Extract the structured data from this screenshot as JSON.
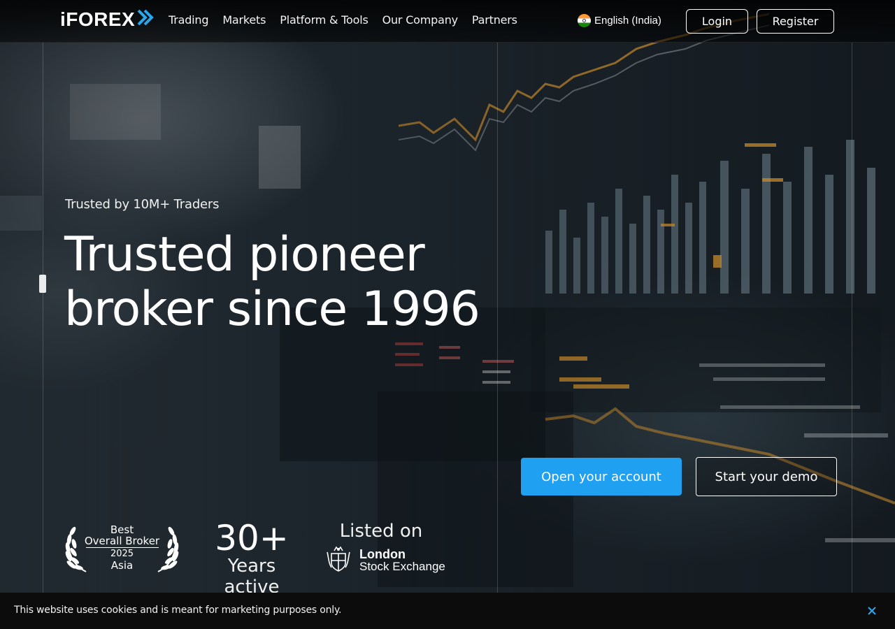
{
  "header": {
    "logo_text": "iFOREX",
    "logo_mark_icon": "double-chevron-icon",
    "nav": [
      {
        "label": "Trading"
      },
      {
        "label": "Markets"
      },
      {
        "label": "Platform & Tools"
      },
      {
        "label": "Our Company"
      },
      {
        "label": "Partners"
      }
    ],
    "language": {
      "label": "English (India)",
      "flag_icon": "india-flag-icon"
    },
    "login_label": "Login",
    "register_label": "Register"
  },
  "hero": {
    "tagline": "Trusted by 10M+ Traders",
    "headline_line1": "Trusted pioneer",
    "headline_line2": "broker since 1996",
    "primary_cta": "Open your account",
    "secondary_cta": "Start your demo"
  },
  "stats": {
    "award": {
      "line1": "Best",
      "line2": "Overall Broker",
      "line3": "2025",
      "line4": "Asia",
      "icon": "laurel-wreath-icon"
    },
    "years": {
      "value": "30+",
      "label": "Years active"
    },
    "listed": {
      "label": "Listed on",
      "exchange_line1": "London",
      "exchange_line2": "Stock Exchange",
      "icon": "lse-crest-icon"
    }
  },
  "cookie": {
    "text": "This website uses cookies and is meant for marketing purposes only.",
    "close_icon": "close-icon"
  },
  "colors": {
    "accent": "#1fa0f0",
    "logo_mark": "#2aa6ee",
    "cookie_bg": "#0c0c0c",
    "close_icon": "#2aa6ee",
    "chart_orange": "#e8a030"
  }
}
